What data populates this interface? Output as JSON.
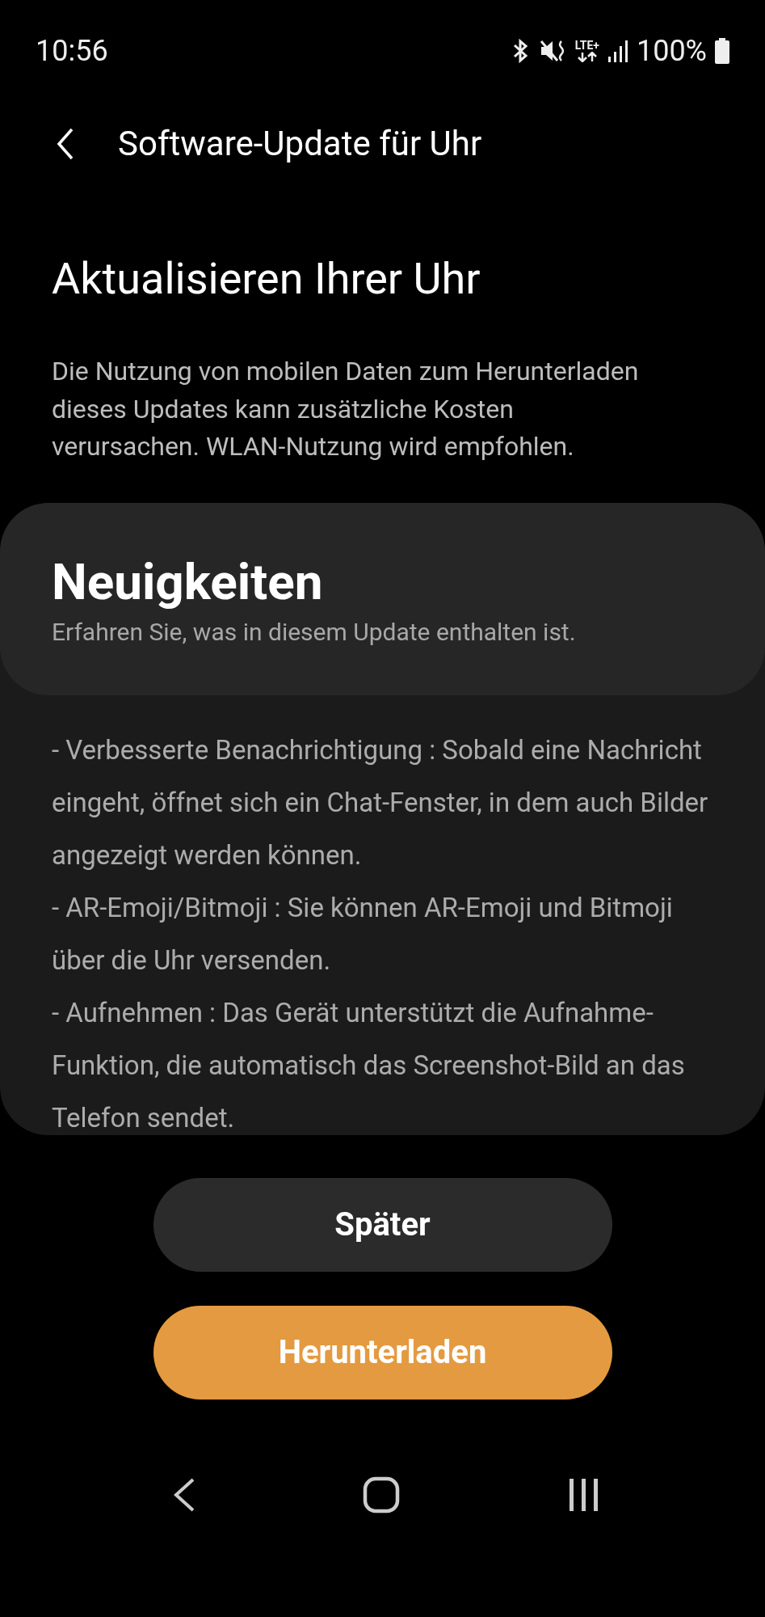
{
  "status_bar": {
    "time": "10:56",
    "network": "LTE+",
    "battery": "100%"
  },
  "app_bar": {
    "title": "Software-Update für Uhr"
  },
  "heading": "Aktualisieren Ihrer Uhr",
  "notice": "Die Nutzung von mobilen Daten zum Herunterladen dieses Updates kann zusätzliche Kosten verursachen. WLAN-Nutzung wird empfohlen.",
  "whats_new": {
    "title": "Neuigkeiten",
    "subtitle": "Erfahren Sie, was in diesem Update enthalten ist.",
    "items": [
      "- Verbesserte Benachrichtigung : Sobald eine Nachricht eingeht, öffnet sich ein Chat-Fenster, in dem auch Bilder angezeigt werden können.",
      "- AR-Emoji/Bitmoji : Sie können AR-Emoji und Bitmoji über die Uhr versenden.",
      "- Aufnehmen : Das Gerät unterstützt die Aufnahme-Funktion, die automatisch das Screenshot-Bild an das Telefon sendet."
    ]
  },
  "buttons": [
    {
      "label": "Später",
      "kind": "secondary"
    },
    {
      "label": "Herunterladen",
      "kind": "primary"
    }
  ]
}
